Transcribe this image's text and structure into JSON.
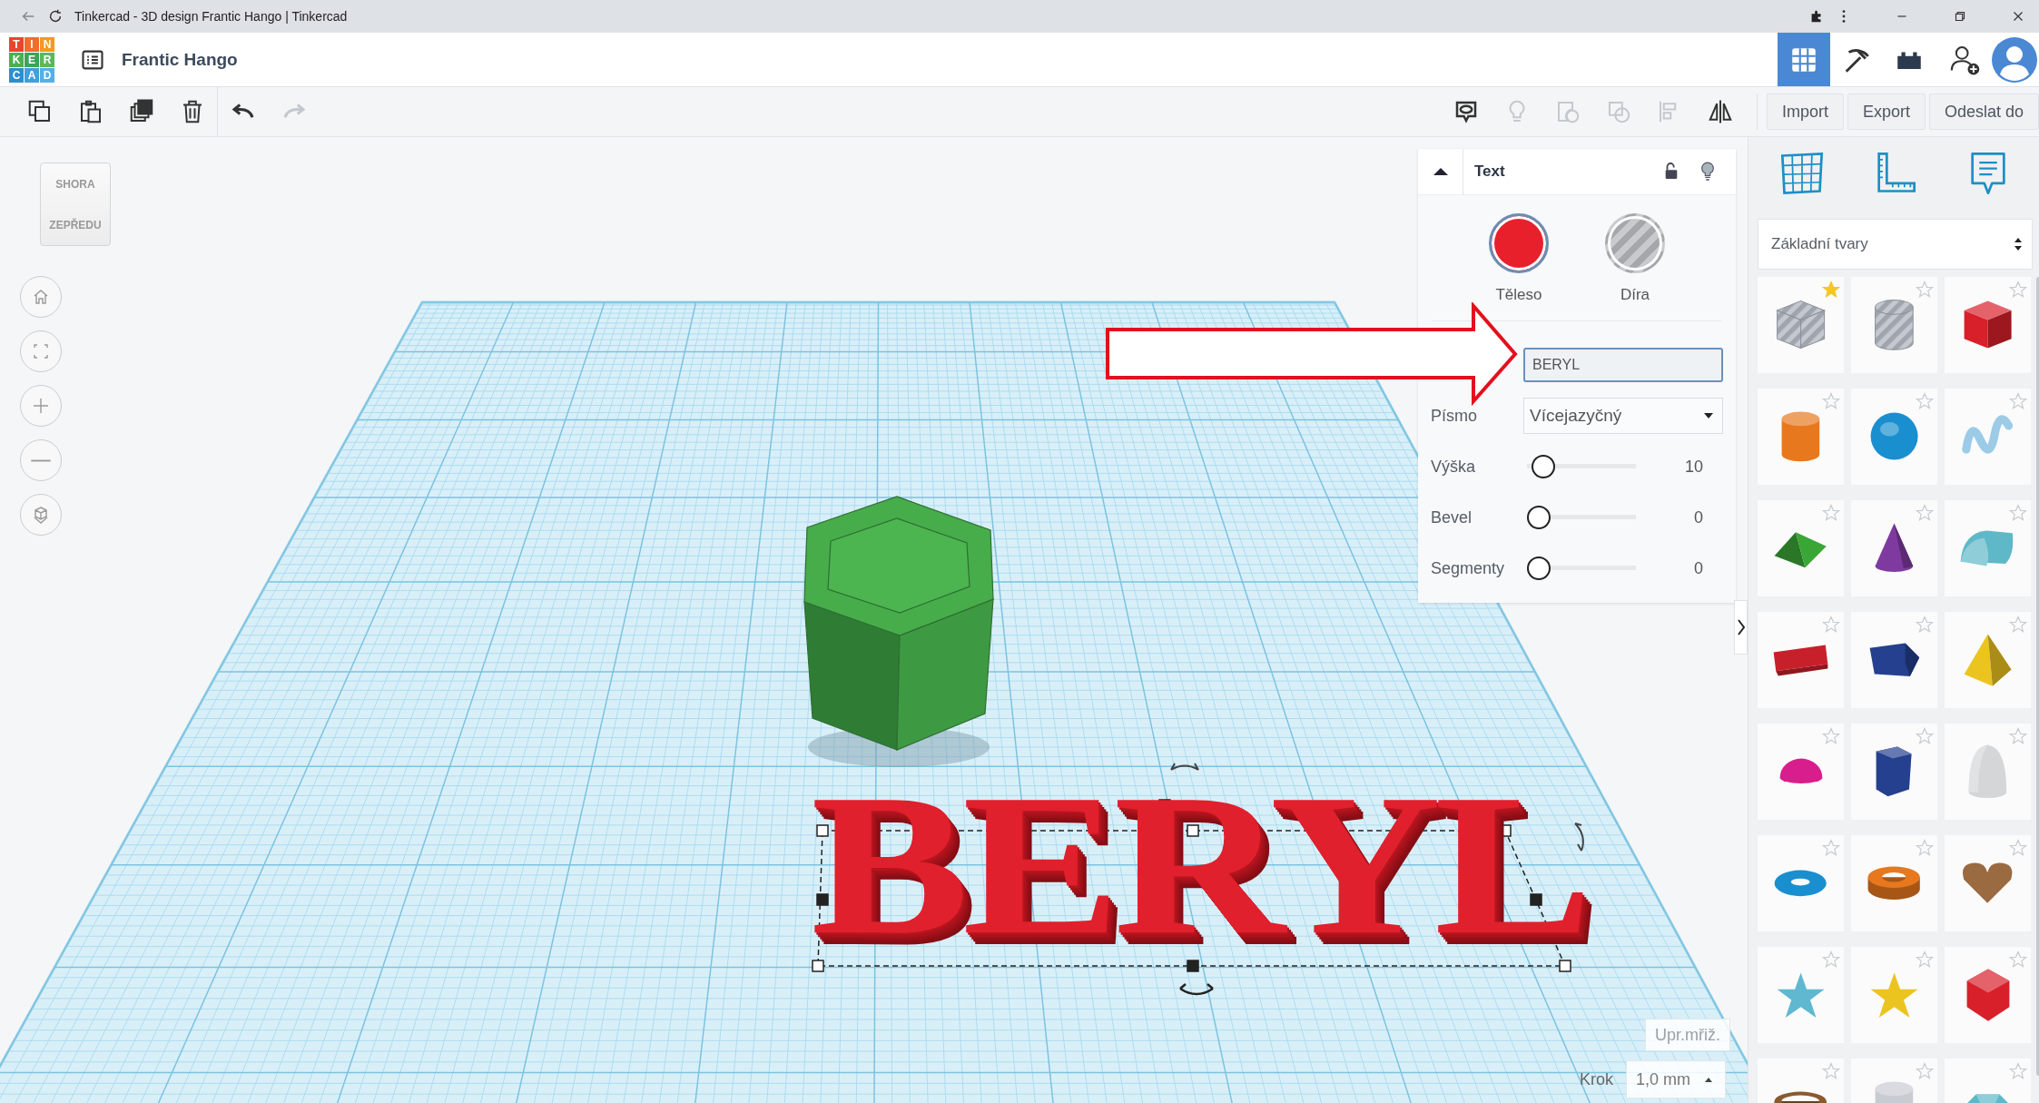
{
  "browser": {
    "title": "Tinkercad - 3D design Frantic Hango | Tinkercad"
  },
  "app": {
    "logo_letters": [
      "T",
      "I",
      "N",
      "K",
      "E",
      "R",
      "C",
      "A",
      "D"
    ],
    "design_name": "Frantic Hango",
    "views": [
      {
        "kind": "grid",
        "selected": true
      },
      {
        "kind": "pickaxe",
        "selected": false
      },
      {
        "kind": "bricks",
        "selected": false
      }
    ]
  },
  "toolbar": {
    "edit_tools": [
      {
        "kind": "copy",
        "disabled": false
      },
      {
        "kind": "paste",
        "disabled": false
      },
      {
        "kind": "duplicate",
        "disabled": false
      },
      {
        "kind": "delete",
        "disabled": false
      },
      {
        "kind": "undo",
        "disabled": false
      },
      {
        "kind": "redo",
        "disabled": true
      }
    ],
    "shape_tools": [
      {
        "kind": "notes",
        "disabled": false
      },
      {
        "kind": "bulb",
        "disabled": true
      },
      {
        "kind": "group",
        "disabled": true
      },
      {
        "kind": "ungroup",
        "disabled": true
      },
      {
        "kind": "align",
        "disabled": true
      },
      {
        "kind": "mirror",
        "disabled": false
      }
    ],
    "buttons": [
      "Import",
      "Export",
      "Odeslat do"
    ]
  },
  "view_cube": {
    "top": "SHORA",
    "front": "ZEPŘEDU"
  },
  "scene": {
    "text_object": "BERYL"
  },
  "inspector": {
    "title": "Text",
    "materials": [
      {
        "label": "Těleso",
        "kind": "solid",
        "selected": true
      },
      {
        "label": "Díra",
        "kind": "hole",
        "selected": false
      }
    ],
    "text_value": "BERYL",
    "font_label": "Písmo",
    "font_value": "Vícejazyčný",
    "sliders": [
      {
        "label": "Výška",
        "level": 0.05,
        "reading": "10"
      },
      {
        "label": "Bevel",
        "level": 0,
        "reading": "0"
      },
      {
        "label": "Segmenty",
        "level": 0,
        "reading": "0"
      }
    ]
  },
  "grid_controls": {
    "edit_grid": "Upr.mřiž.",
    "snap_label": "Krok",
    "snap_value": "1,0 mm"
  },
  "library": {
    "category": "Základní tvary",
    "shapes": [
      {
        "kind": "box",
        "color": "#b9bdc6",
        "hole": true,
        "favorite": true
      },
      {
        "kind": "cylinder",
        "color": "#b9bdc6",
        "hole": true,
        "favorite": false
      },
      {
        "kind": "box",
        "color": "#d8202a",
        "hole": false,
        "favorite": false
      },
      {
        "kind": "cylinder",
        "color": "#e8781e",
        "hole": false,
        "favorite": false
      },
      {
        "kind": "sphere",
        "color": "#1a8fd0",
        "hole": false,
        "favorite": false
      },
      {
        "kind": "scribble",
        "color": "#9ccbe8",
        "hole": false,
        "favorite": false
      },
      {
        "kind": "roof",
        "color": "#3aa636",
        "hole": false,
        "favorite": false
      },
      {
        "kind": "cone",
        "color": "#7f3aa0",
        "hole": false,
        "favorite": false
      },
      {
        "kind": "round-roof",
        "color": "#5fb8c8",
        "hole": false,
        "favorite": false
      },
      {
        "kind": "text",
        "color": "#c8202a",
        "hole": false,
        "favorite": false
      },
      {
        "kind": "polygon",
        "color": "#24408e",
        "hole": false,
        "favorite": false
      },
      {
        "kind": "pyramid",
        "color": "#ecc420",
        "hole": false,
        "favorite": false
      },
      {
        "kind": "half-sphere",
        "color": "#d81e8c",
        "hole": false,
        "favorite": false
      },
      {
        "kind": "hex-prism",
        "color": "#24408e",
        "hole": false,
        "favorite": false
      },
      {
        "kind": "paraboloid",
        "color": "#d4d6d8",
        "hole": false,
        "favorite": false
      },
      {
        "kind": "torus",
        "color": "#1a8fd0",
        "hole": false,
        "favorite": false
      },
      {
        "kind": "tube",
        "color": "#e8781e",
        "hole": false,
        "favorite": false
      },
      {
        "kind": "heart",
        "color": "#9a6a40",
        "hole": false,
        "favorite": false
      },
      {
        "kind": "star",
        "color": "#5fb8d0",
        "hole": false,
        "favorite": false
      },
      {
        "kind": "star",
        "color": "#ecc420",
        "hole": false,
        "favorite": false
      },
      {
        "kind": "polyhedron",
        "color": "#d8202a",
        "hole": false,
        "favorite": false
      },
      {
        "kind": "ring",
        "color": "#8a5a30",
        "hole": false,
        "favorite": false
      },
      {
        "kind": "cylinder",
        "color": "#c8ccd2",
        "hole": false,
        "favorite": false
      },
      {
        "kind": "gem",
        "color": "#5fb8c8",
        "hole": false,
        "favorite": false
      }
    ]
  }
}
